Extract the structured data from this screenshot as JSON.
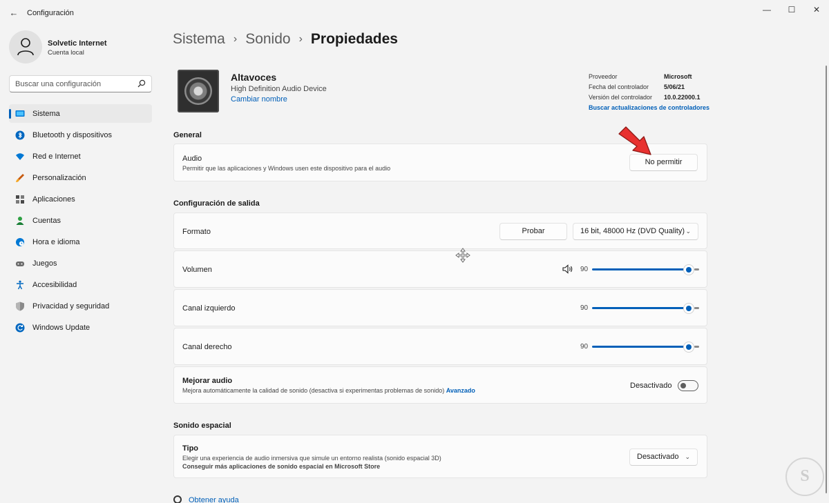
{
  "window": {
    "title": "Configuración",
    "back_icon": "←",
    "minimize_icon": "—",
    "maximize_icon": "☐",
    "close_icon": "✕"
  },
  "profile": {
    "name": "Solvetic Internet",
    "account_type": "Cuenta local"
  },
  "search": {
    "placeholder": "Buscar una configuración"
  },
  "sidebar": {
    "items": [
      {
        "label": "Sistema",
        "icon": "system-icon",
        "active": true
      },
      {
        "label": "Bluetooth y dispositivos",
        "icon": "bluetooth-icon"
      },
      {
        "label": "Red e Internet",
        "icon": "wifi-icon"
      },
      {
        "label": "Personalización",
        "icon": "brush-icon"
      },
      {
        "label": "Aplicaciones",
        "icon": "apps-icon"
      },
      {
        "label": "Cuentas",
        "icon": "person-icon"
      },
      {
        "label": "Hora e idioma",
        "icon": "globe-clock-icon"
      },
      {
        "label": "Juegos",
        "icon": "gamepad-icon"
      },
      {
        "label": "Accesibilidad",
        "icon": "accessibility-icon"
      },
      {
        "label": "Privacidad y seguridad",
        "icon": "shield-icon"
      },
      {
        "label": "Windows Update",
        "icon": "update-icon"
      }
    ]
  },
  "breadcrumb": {
    "items": [
      "Sistema",
      "Sonido"
    ],
    "current": "Propiedades"
  },
  "device": {
    "name": "Altavoces",
    "description": "High Definition Audio Device",
    "rename_link": "Cambiar nombre"
  },
  "driver": {
    "provider_label": "Proveedor",
    "provider_value": "Microsoft",
    "date_label": "Fecha del controlador",
    "date_value": "5/06/21",
    "version_label": "Versión del controlador",
    "version_value": "10.0.22000.1",
    "update_link": "Buscar actualizaciones de controladores"
  },
  "general": {
    "title": "General",
    "audio_label": "Audio",
    "audio_desc": "Permitir que las aplicaciones y Windows usen este dispositivo para el audio",
    "audio_button": "No permitir"
  },
  "output": {
    "title": "Configuración de salida",
    "format_label": "Formato",
    "test_button": "Probar",
    "format_value": "16 bit, 48000 Hz (DVD Quality)",
    "volume_label": "Volumen",
    "volume_value": "90",
    "left_label": "Canal izquierdo",
    "left_value": "90",
    "right_label": "Canal derecho",
    "right_value": "90",
    "enhance_label": "Mejorar audio",
    "enhance_desc": "Mejora automáticamente la calidad de sonido (desactiva si experimentas problemas de sonido)",
    "enhance_link": "Avanzado",
    "enhance_state": "Desactivado"
  },
  "spatial": {
    "title": "Sonido espacial",
    "type_label": "Tipo",
    "type_desc": "Elegir una experiencia de audio inmersiva que simule un entorno realista (sonido espacial 3D)",
    "store_link": "Conseguir más aplicaciones de sonido espacial en Microsoft Store",
    "type_value": "Desactivado"
  },
  "help": {
    "label": "Obtener ayuda"
  },
  "watermark": {
    "text": "S"
  },
  "colors": {
    "accent": "#005fb8",
    "annotation_arrow": "#e8312f"
  },
  "slider_levels": {
    "volume": 0.9,
    "left": 0.9,
    "right": 0.9
  }
}
